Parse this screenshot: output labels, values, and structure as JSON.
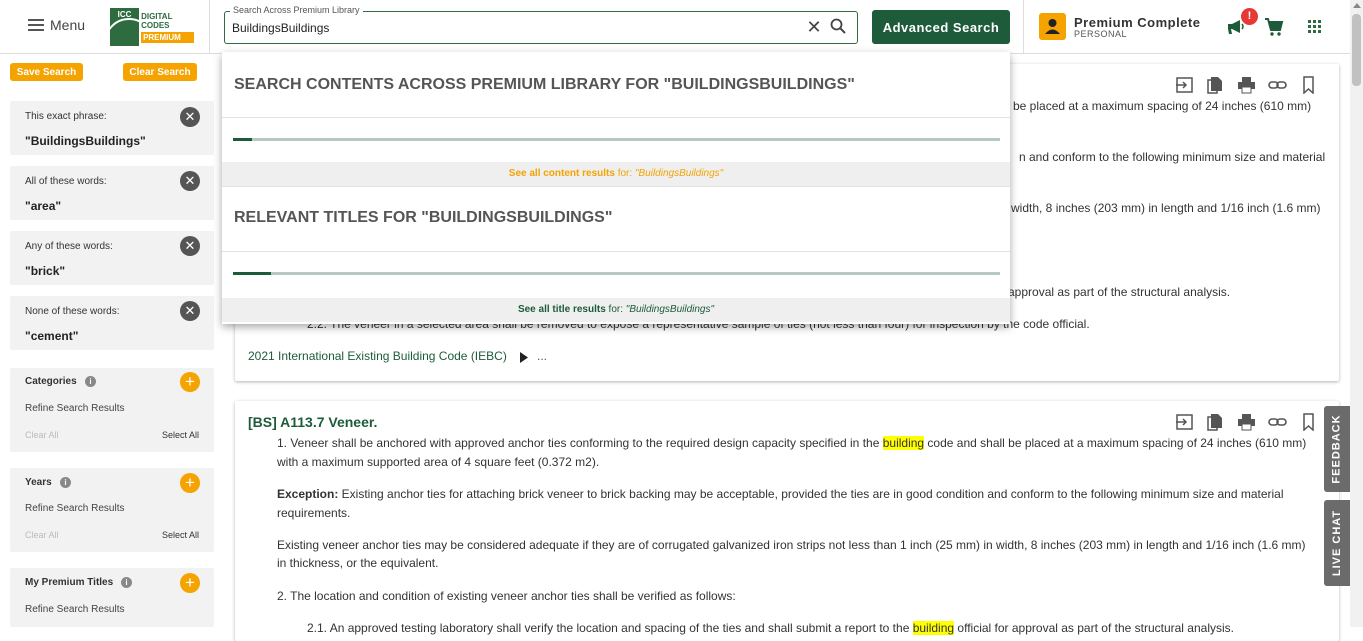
{
  "header": {
    "menu_label": "Menu",
    "logo": {
      "mark_text": "ICC",
      "line1": "DIGITAL CODES",
      "line2": "PREMIUM"
    },
    "search": {
      "legend": "Search Across Premium Library",
      "value": "BuildingsBuildings",
      "clear_glyph": "✕"
    },
    "advanced_search_label": "Advanced Search",
    "account": {
      "plan_name": "Premium Complete",
      "plan_type": "PERSONAL"
    },
    "notification_badge": "!"
  },
  "sidebar": {
    "save_search_label": "Save Search",
    "clear_search_label": "Clear Search",
    "filters": [
      {
        "label": "This exact phrase:",
        "value": "\"BuildingsBuildings\""
      },
      {
        "label": "All of these words:",
        "value": "\"area\""
      },
      {
        "label": "Any of these words:",
        "value": "\"brick\""
      },
      {
        "label": "None of these words:",
        "value": "\"cement\""
      }
    ],
    "sections": [
      {
        "title": "Categories",
        "refine": "Refine Search Results",
        "clear_all": "Clear All",
        "select_all": "Select All"
      },
      {
        "title": "Years",
        "refine": "Refine Search Results",
        "clear_all": "Clear All",
        "select_all": "Select All"
      },
      {
        "title": "My Premium Titles",
        "refine": "Refine Search Results"
      }
    ],
    "remove_glyph": "✕",
    "add_glyph": "+",
    "info_glyph": "i"
  },
  "dropdown": {
    "content_heading": "SEARCH CONTENTS ACROSS PREMIUM LIBRARY FOR \"BUILDINGSBUILDINGS\"",
    "content_progress": 0.025,
    "content_link_prefix": "See all content results",
    "content_link_for": " for: ",
    "content_link_query": "\"BuildingsBuildings\"",
    "titles_heading": "RELEVANT TITLES FOR \"BUILDINGSBUILDINGS\"",
    "titles_progress": 0.05,
    "titles_link_prefix": "See all title results",
    "titles_link_for": " for: ",
    "titles_link_query": "\"BuildingsBuildings\"",
    "link_color_content": "#f4a300",
    "link_color_titles": "#1d5b3a"
  },
  "card1": {
    "frag1": "be placed at a maximum spacing of 24 inches (610 mm)",
    "frag2": "n and conform to the following minimum size and material",
    "frag3": "width, 8 inches (203 mm) in length and 1/16 inch (1.6 mm)",
    "frag4": "approval as part of the structural analysis.",
    "item22": "2.2. The veneer in a selected area shall be removed to expose a representative sample of ties (not less than four) for inspection by the code official.",
    "book_link": "2021 International Existing Building Code (IEBC)",
    "more": "..."
  },
  "card2": {
    "title": "[BS] A113.7 Veneer.",
    "p1a": "1. Veneer shall be anchored with approved anchor ties conforming to the required design capacity specified in the ",
    "p1_hl": "building",
    "p1b": " code and shall be placed at a maximum spacing of 24 inches (610 mm)",
    "p1c": "with a maximum supported area of 4 square feet (0.372 m2).",
    "exc_label": "Exception:",
    "exc_text": " Existing anchor ties for attaching brick veneer to brick backing may be acceptable, provided the ties are in good condition and conform to the following minimum size and material",
    "exc_text2": "requirements.",
    "p3a": "Existing veneer anchor ties may be considered adequate if they are of corrugated galvanized iron strips not less than 1 inch (25 mm) in width, 8 inches (203 mm) in length and 1/16 inch (1.6 mm)",
    "p3b": "in thickness, or the equivalent.",
    "p4": "2. The location and condition of existing veneer anchor ties shall be verified as follows:",
    "p5a": "2.1. An approved testing laboratory shall verify the location and spacing of the ties and shall submit a report to the ",
    "p5_hl": "building",
    "p5b": " official for approval as part of the structural analysis."
  },
  "side_tabs": {
    "feedback": "FEEDBACK",
    "live_chat": "LIVE CHAT"
  },
  "colors": {
    "brand_green": "#1d5b3a",
    "accent_orange": "#f4a300",
    "highlight": "#ffff00"
  }
}
